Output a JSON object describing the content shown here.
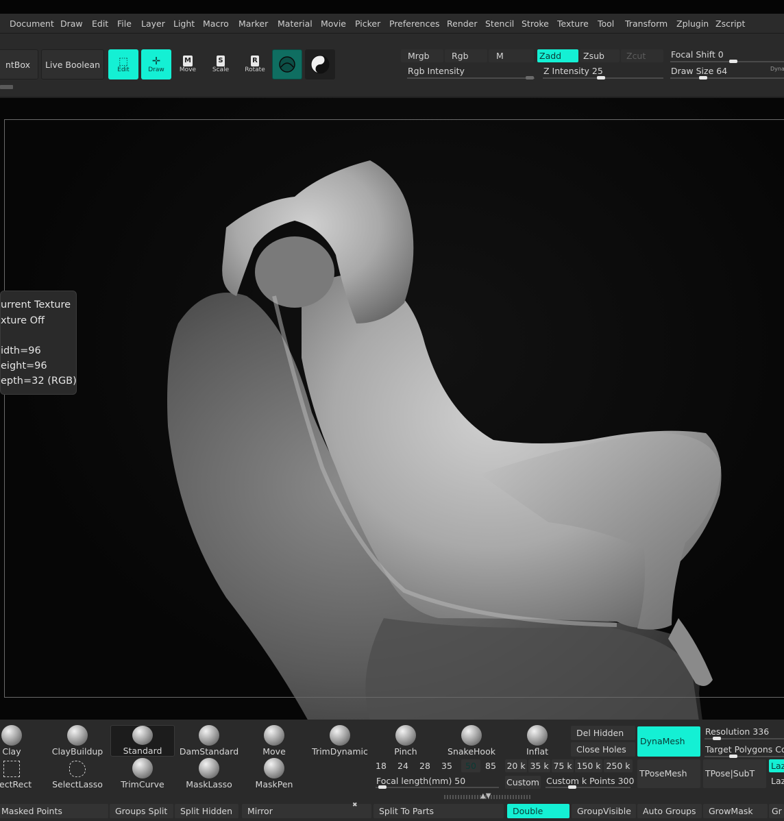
{
  "menu": [
    "Document",
    "Draw",
    "Edit",
    "File",
    "Layer",
    "Light",
    "Macro",
    "Marker",
    "Material",
    "Movie",
    "Picker",
    "Preferences",
    "Render",
    "Stencil",
    "Stroke",
    "Texture",
    "Tool",
    "Transform",
    "Zplugin",
    "Zscript"
  ],
  "toolbar": {
    "lightbox_label": "ntBox",
    "live_boolean_label": "Live Boolean",
    "modes": [
      {
        "label": "Edit",
        "glyph": "⬚",
        "active": true
      },
      {
        "label": "Draw",
        "glyph": "✛",
        "active": true
      },
      {
        "label": "Move",
        "glyph": "M",
        "active": false
      },
      {
        "label": "Scale",
        "glyph": "S",
        "active": false
      },
      {
        "label": "Rotate",
        "glyph": "R",
        "active": false
      }
    ],
    "mrgb": "Mrgb",
    "rgb": "Rgb",
    "m": "M",
    "zadd": "Zadd",
    "zsub": "Zsub",
    "zcut": "Zcut",
    "rgb_intensity": "Rgb Intensity",
    "z_intensity_label": "Z Intensity 25",
    "focal_shift_label": "Focal Shift 0",
    "draw_size_label": "Draw Size 64",
    "dyna_label": "Dyna",
    "z_intensity": 25,
    "focal_shift": 0,
    "draw_size": 64
  },
  "tooltip": {
    "line1": "urrent Texture",
    "line2": "xture Off",
    "line3": "idth=96",
    "line4": "eight=96",
    "line5": "epth=32 (RGB)"
  },
  "brushes_row1": [
    "Clay",
    "ClayBuildup",
    "Standard",
    "DamStandard",
    "Move",
    "TrimDynamic",
    "Pinch",
    "SnakeHook",
    "Inflat"
  ],
  "brushes_row2": [
    "electRect",
    "SelectLasso",
    "TrimCurve",
    "MaskLasso",
    "MaskPen"
  ],
  "selected_brush": "Standard",
  "focal_lengths": [
    "18",
    "24",
    "28",
    "35",
    "50",
    "85"
  ],
  "selected_focal": "50",
  "focal_length_label": "Focal length(mm) 50",
  "kpoints": [
    "20 k",
    "35 k",
    "75 k",
    "150 k",
    "250 k"
  ],
  "custom_label": "Custom",
  "custom_kpoints_label": "Custom k Points 300",
  "mesh_ops": {
    "del_hidden": "Del Hidden",
    "close_holes": "Close Holes",
    "dynamesh": "DynaMesh",
    "resolution_label": "Resolution 336",
    "target_polygons_label": "Target Polygons Cou",
    "tposemesh": "TPoseMesh",
    "tpose_subt": "TPose|SubT",
    "laz1": "Laz",
    "laz2": "Laz"
  },
  "bottom_row": [
    "Masked Points",
    "Groups Split",
    "Split Hidden",
    "Mirror",
    "Split To Parts",
    "Double",
    "GroupVisible",
    "Auto Groups",
    "GrowMask",
    "Gr"
  ],
  "colors": {
    "accent": "#14f0d4",
    "panel": "#2a2a2a",
    "background": "#0d0d0d"
  }
}
